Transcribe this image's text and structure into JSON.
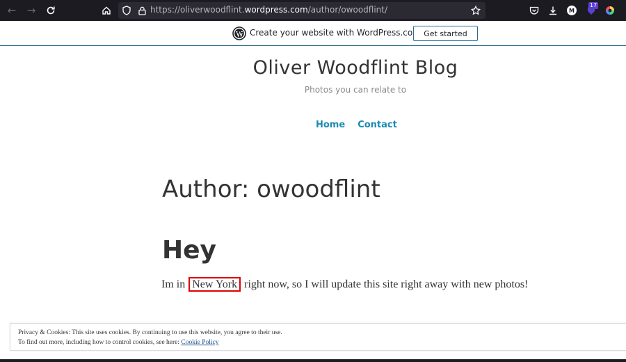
{
  "browser": {
    "url_prefix": "https://oliverwoodflint.",
    "url_domain": "wordpress.com",
    "url_path": "/author/owoodflint/",
    "extension_badge": "17",
    "account_initial": "M",
    "icons": [
      "back-icon",
      "forward-icon",
      "reload-icon",
      "home-icon",
      "shield-icon",
      "lock-icon",
      "bookmark-star-icon",
      "pocket-icon",
      "download-icon",
      "account-icon",
      "extension-icon",
      "color-extension-icon"
    ]
  },
  "wp_banner": {
    "text": "Create your website with WordPress.com",
    "button": "Get started"
  },
  "site": {
    "title": "Oliver Woodflint Blog",
    "description": "Photos you can relate to",
    "nav": [
      "Home",
      "Contact"
    ]
  },
  "page": {
    "title": "Author: owoodflint"
  },
  "post": {
    "title": "Hey",
    "text_before": "Im in ",
    "highlight": "New York",
    "text_after": " right now, so I will update this site right away with new photos!"
  },
  "cookie": {
    "line1": "Privacy & Cookies: This site uses cookies. By continuing to use this website, you agree to their use.",
    "line2": "To find out more, including how to control cookies, see here: ",
    "link": "Cookie Policy"
  },
  "colors": {
    "accent": "#1a8bb3",
    "highlight_border": "#e00000",
    "toolbar_bg": "#1c1b22"
  }
}
